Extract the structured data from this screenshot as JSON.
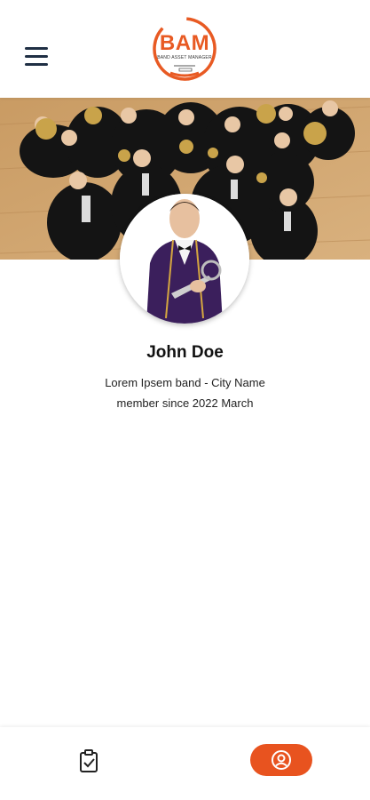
{
  "header": {
    "logo_text": "BAM",
    "logo_subtitle": "BAND ASSET MANAGER",
    "menu_icon": "hamburger-menu-icon"
  },
  "profile": {
    "name": "John Doe",
    "band_line": "Lorem Ipsem band - City Name",
    "member_since": "member since 2022 March"
  },
  "bottom_nav": {
    "items": [
      {
        "icon": "clipboard-check-icon",
        "active": false
      },
      {
        "icon": "user-circle-icon",
        "active": true
      }
    ]
  },
  "colors": {
    "accent": "#e8531f",
    "menu_icon": "#1f2f44",
    "background": "#ffffff"
  }
}
